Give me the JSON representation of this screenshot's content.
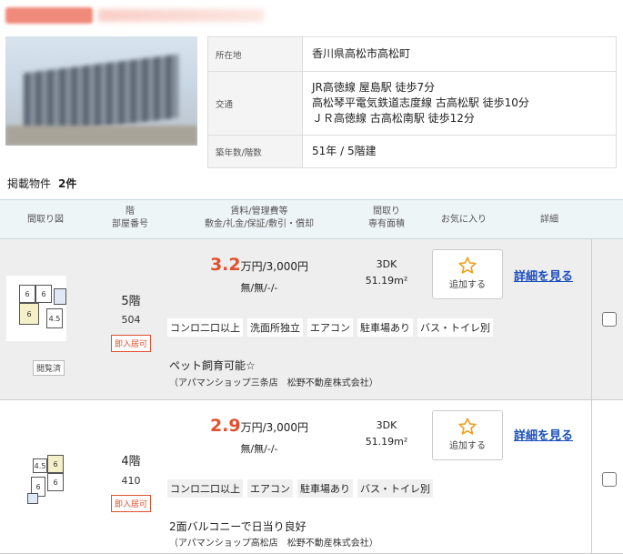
{
  "header": {
    "badge": "",
    "blurred_title": ""
  },
  "info": {
    "location_label": "所在地",
    "location": "香川県高松市高松町",
    "access_label": "交通",
    "access": [
      "JR高徳線 屋島駅 徒歩7分",
      "高松琴平電気鉄道志度線 古高松駅 徒歩10分",
      "ＪＲ高徳線 古高松南駅 徒歩12分"
    ],
    "age_label": "築年数/階数",
    "age": "51年 / 5階建"
  },
  "listing_count": {
    "label": "掲載物件",
    "value": "2件"
  },
  "table_header": {
    "floorplan": "間取り図",
    "floor_room": [
      "階",
      "部屋番号"
    ],
    "rent": [
      "賃料/管理費等",
      "敷金/礼金/保証/敷引・償却"
    ],
    "layout": [
      "間取り",
      "専有面積"
    ],
    "favorite": "お気に入り",
    "detail": "詳細"
  },
  "rows": [
    {
      "viewed": "閲覧済",
      "floor": "5階",
      "room": "504",
      "move_in": "即入居可",
      "rent_value": "3.2",
      "rent_unit": "万円/3,000円",
      "deposit": "無/無/-/-",
      "layout": "3DK",
      "area": "51.19m²",
      "fav_label": "追加する",
      "detail_link": "詳細を見る",
      "tags": [
        "コンロ二口以上",
        "洗面所独立",
        "エアコン",
        "駐車場あり",
        "バス・トイレ別"
      ],
      "note": "ペット飼育可能☆",
      "shop": "（アパマンショップ三条店　松野不動産株式会社）",
      "plan_rooms": [
        "6",
        "6",
        "6",
        "4.5"
      ]
    },
    {
      "floor": "4階",
      "room": "410",
      "move_in": "即入居可",
      "rent_value": "2.9",
      "rent_unit": "万円/3,000円",
      "deposit": "無/無/-/-",
      "layout": "3DK",
      "area": "51.19m²",
      "fav_label": "追加する",
      "detail_link": "詳細を見る",
      "tags": [
        "コンロ二口以上",
        "エアコン",
        "駐車場あり",
        "バス・トイレ別"
      ],
      "note": "2面バルコニーで日当り良好",
      "shop": "（アパマンショップ高松店　松野不動産株式会社）",
      "plan_rooms": [
        "4.5",
        "6",
        "6",
        "6"
      ]
    }
  ],
  "colors": {
    "accent": "#e0502e",
    "link": "#1a4dbb",
    "header_bg": "#eef5f6",
    "row_highlight": "#eeeeee",
    "star": "#f0a020"
  },
  "icons": [
    "star-icon",
    "checkbox"
  ]
}
